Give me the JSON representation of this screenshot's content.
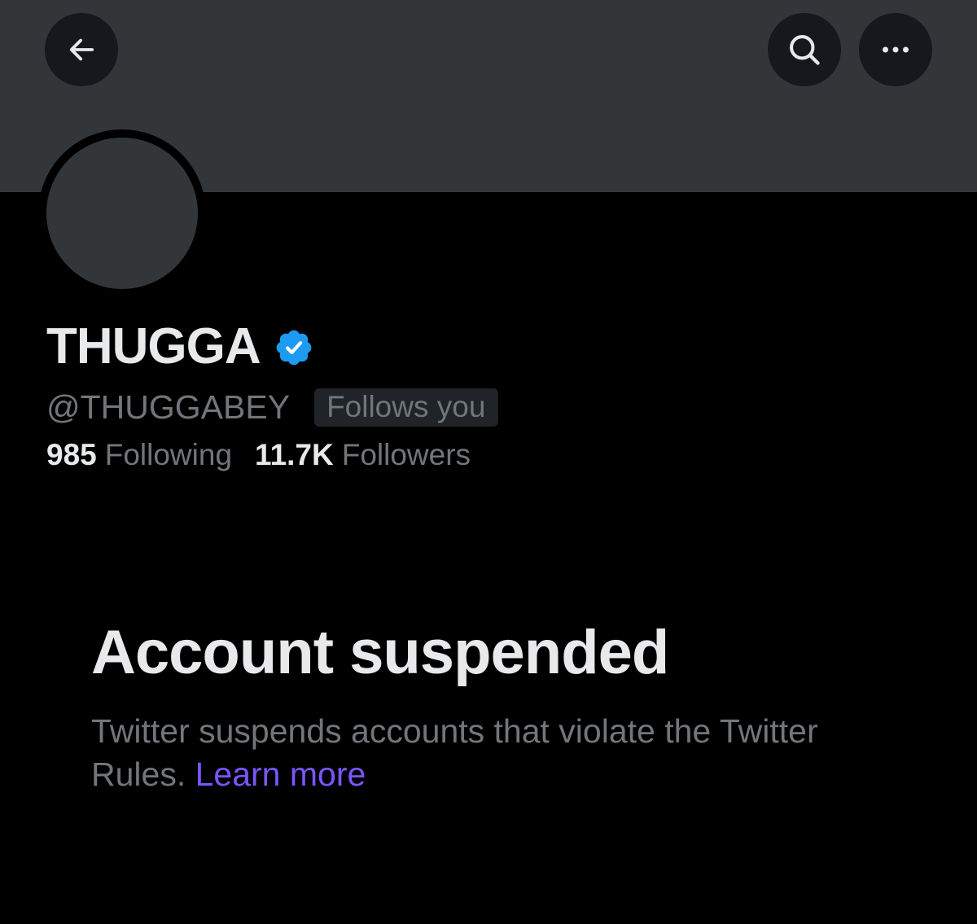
{
  "header": {
    "back_icon": "arrow-left-icon",
    "search_icon": "search-icon",
    "more_icon": "more-horizontal-icon"
  },
  "profile": {
    "display_name": "THUGGA",
    "verified_badge_icon": "verified-badge-icon",
    "verified_color": "#1d9bf0",
    "handle": "@THUGGABEY",
    "follows_you_label": "Follows you",
    "following_count": "985",
    "following_label": "Following",
    "followers_count": "11.7K",
    "followers_label": "Followers"
  },
  "suspension": {
    "title": "Account suspended",
    "message": "Twitter suspends accounts that violate the Twitter Rules.",
    "link_label": "Learn more",
    "link_color": "#7856ff"
  },
  "colors": {
    "background": "#000000",
    "banner": "#333639",
    "primary_text": "#e7e9ea",
    "secondary_text": "#71767b"
  }
}
